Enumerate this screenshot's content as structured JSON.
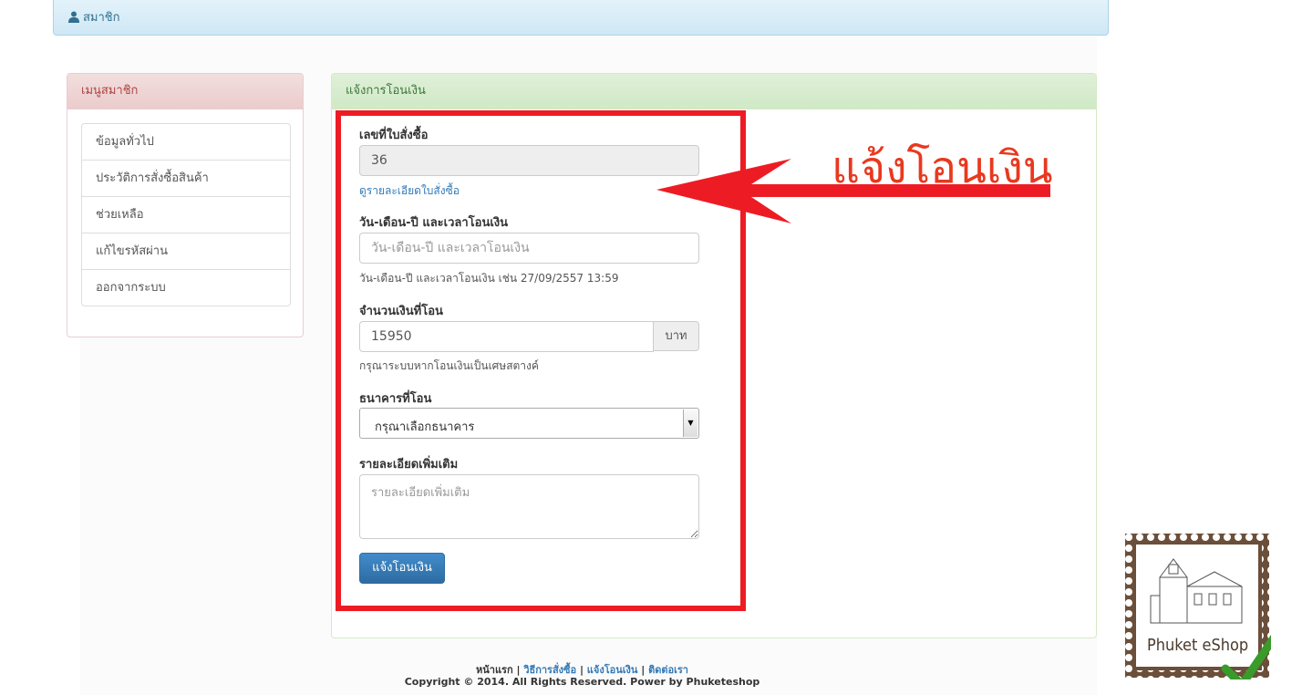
{
  "topbar": {
    "user_label": "สมาชิก"
  },
  "sidebar": {
    "title": "เมนูสมาชิก",
    "items": [
      {
        "label": "ข้อมูลทั่วไป"
      },
      {
        "label": "ประวัติการสั่งซื้อสินค้า"
      },
      {
        "label": "ช่วยเหลือ"
      },
      {
        "label": "แก้ไขรหัสผ่าน"
      },
      {
        "label": "ออกจากระบบ"
      }
    ]
  },
  "form": {
    "title": "แจ้งการโอนเงิน",
    "order_no_label": "เลขที่ใบสั่งซื้อ",
    "order_no_value": "36",
    "order_detail_link": "ดูรายละเอียดใบสั่งซื้อ",
    "datetime_label": "วัน-เดือน-ปี และเวลาโอนเงิน",
    "datetime_placeholder": "วัน-เดือน-ปี และเวลาโอนเงิน",
    "datetime_help": "วัน-เดือน-ปี และเวลาโอนเงิน เช่น 27/09/2557 13:59",
    "amount_label": "จำนวนเงินที่โอน",
    "amount_value": "15950",
    "amount_unit": "บาท",
    "amount_help": "กรุณาระบบหากโอนเงินเป็นเศษสตางค์",
    "bank_label": "ธนาคารที่โอน",
    "bank_selected": "กรุณาเลือกธนาคาร",
    "details_label": "รายละเอียดเพิ่มเติม",
    "details_placeholder": "รายละเอียดเพิ่มเติม",
    "submit_label": "แจ้งโอนเงิน"
  },
  "annotation": {
    "text": "แจ้งโอนเงิน",
    "color": "#ed1c24"
  },
  "footer": {
    "home": "หน้าแรก",
    "how_to_order": "วิธีการสั่งซื้อ",
    "notify_transfer": "แจ้งโอนเงิน",
    "contact": "ติดต่อเรา",
    "separator": " | ",
    "copyright": "Copyright © 2014. All Rights Reserved. Power by Phuketeshop"
  },
  "logo": {
    "text": "Phuket eShop"
  }
}
